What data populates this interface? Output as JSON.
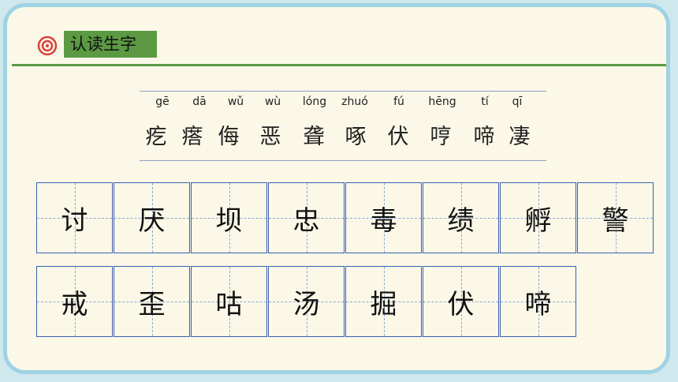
{
  "header": {
    "title": "认读生字"
  },
  "pinyin": [
    "gē",
    "dā",
    "wǔ",
    "wù",
    "lóng",
    "zhuó",
    "fú",
    "hēng",
    "tí",
    "qī"
  ],
  "hanzi": [
    "疙",
    "瘩",
    "侮",
    "恶",
    "聋",
    "啄",
    "伏",
    "哼",
    "啼",
    "凄"
  ],
  "grid_row1": [
    "讨",
    "厌",
    "坝",
    "忠",
    "毒",
    "绩",
    "孵",
    "警"
  ],
  "grid_row2": [
    "戒",
    "歪",
    "咕",
    "汤",
    "掘",
    "伏",
    "啼"
  ],
  "colors": {
    "accent_green": "#5b9a43",
    "frame_blue": "#9fd3e3",
    "target_red": "#d9413a",
    "grid_blue": "#3a5fb0"
  },
  "icons": {
    "title_badge": "target-icon"
  }
}
